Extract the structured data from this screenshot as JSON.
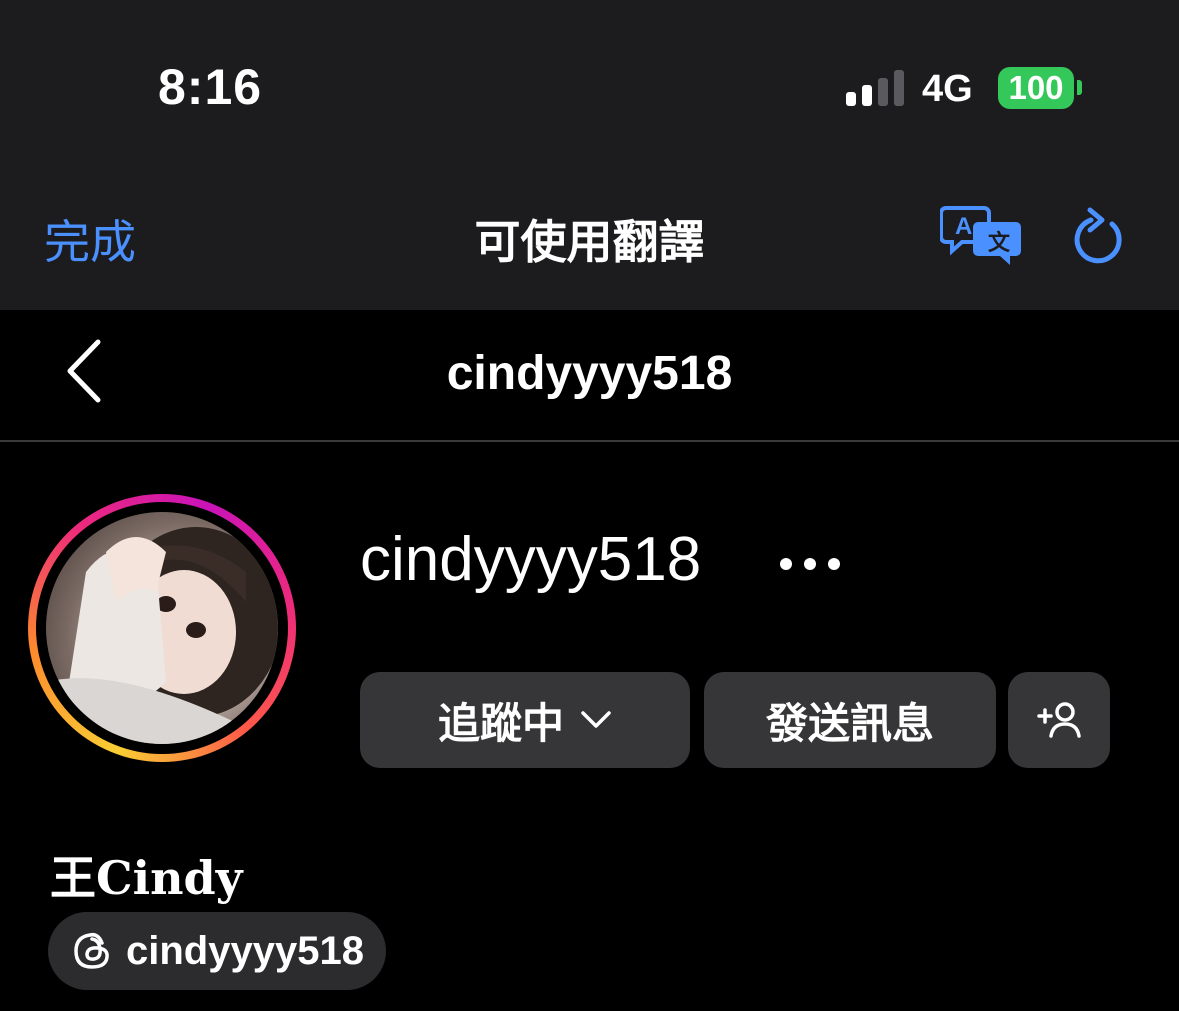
{
  "status_bar": {
    "time": "8:16",
    "network": "4G",
    "battery": "100"
  },
  "translate_bar": {
    "done_label": "完成",
    "title": "可使用翻譯",
    "translate_icon": "translate-icon",
    "refresh_icon": "refresh-icon"
  },
  "header": {
    "username": "cindyyyy518",
    "back_icon": "back-chevron-icon"
  },
  "profile": {
    "username": "cindyyyy518",
    "more_icon": "more-dots-icon",
    "full_name": "王Cindy",
    "threads_handle": "cindyyyy518"
  },
  "actions": {
    "following_label": "追蹤中",
    "message_label": "發送訊息",
    "add_user_icon": "add-person-icon"
  },
  "colors": {
    "accent_blue": "#4a90ff",
    "battery_green": "#34c759",
    "button_bg": "#363638"
  }
}
